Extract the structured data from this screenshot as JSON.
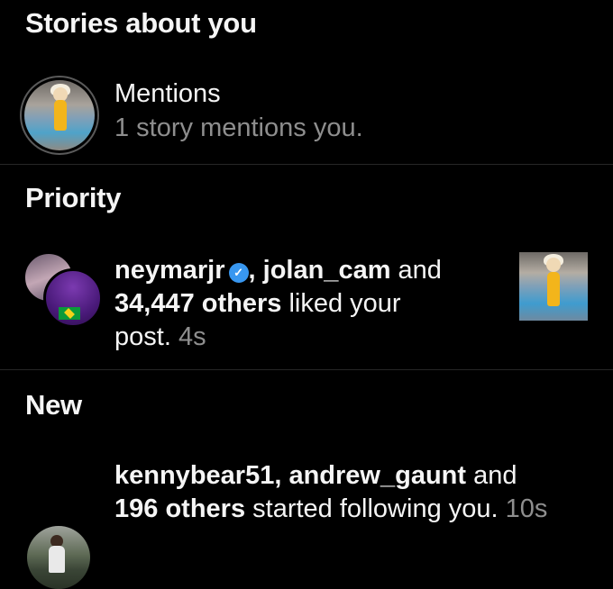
{
  "sections": {
    "stories": {
      "title": "Stories about you"
    },
    "priority": {
      "title": "Priority"
    },
    "new": {
      "title": "New"
    }
  },
  "mentions": {
    "title": "Mentions",
    "subtitle": "1 story mentions you."
  },
  "priority_item": {
    "user1": "neymarjr",
    "user2": "jolan_cam",
    "and": "and",
    "others": "34,447 others",
    "action": "liked your",
    "action2": "post.",
    "time": "4s",
    "verified_icon": "verified-badge-icon",
    "verified_color": "#3897f0"
  },
  "new_item": {
    "user1": "kennybear51",
    "user2": "andrew_gaunt",
    "and": "and",
    "others": "196 others",
    "action": "started following you.",
    "time": "10s"
  }
}
